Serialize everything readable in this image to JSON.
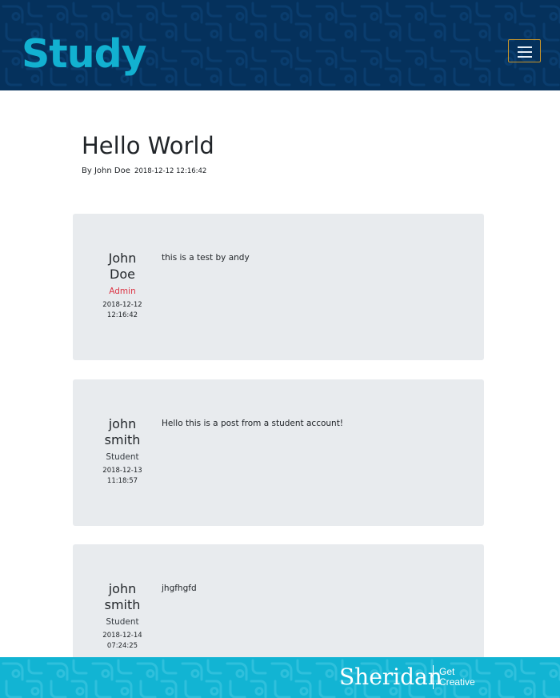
{
  "header": {
    "brand": "Study",
    "menu_icon": "hamburger-menu-icon"
  },
  "post": {
    "title": "Hello World",
    "by_label": "By John Doe",
    "date": "2018-12-12 12:16:42"
  },
  "comments": [
    {
      "name_line1": "John",
      "name_line2": "Doe",
      "role": "Admin",
      "date_line1": "2018-12-12",
      "date_line2": "12:16:42",
      "text": "this is a test by andy"
    },
    {
      "name_line1": "john",
      "name_line2": "smith",
      "role": "Student",
      "date_line1": "2018-12-13",
      "date_line2": "11:18:57",
      "text": "Hello this is a post from a student account!"
    },
    {
      "name_line1": "john",
      "name_line2": "smith",
      "role": "Student",
      "date_line1": "2018-12-14",
      "date_line2": "07:24:25",
      "text": "jhgfhgfd"
    }
  ],
  "footer": {
    "logo_text": "Sheridan",
    "tagline_line1": "Get",
    "tagline_line2": "Creative"
  },
  "colors": {
    "header_bg": "#05315c",
    "brand": "#12b1d1",
    "menu_border": "#c9962a",
    "card_bg": "#e8ebee",
    "admin_role": "#dc3545",
    "footer_bg": "#12b4d3"
  }
}
